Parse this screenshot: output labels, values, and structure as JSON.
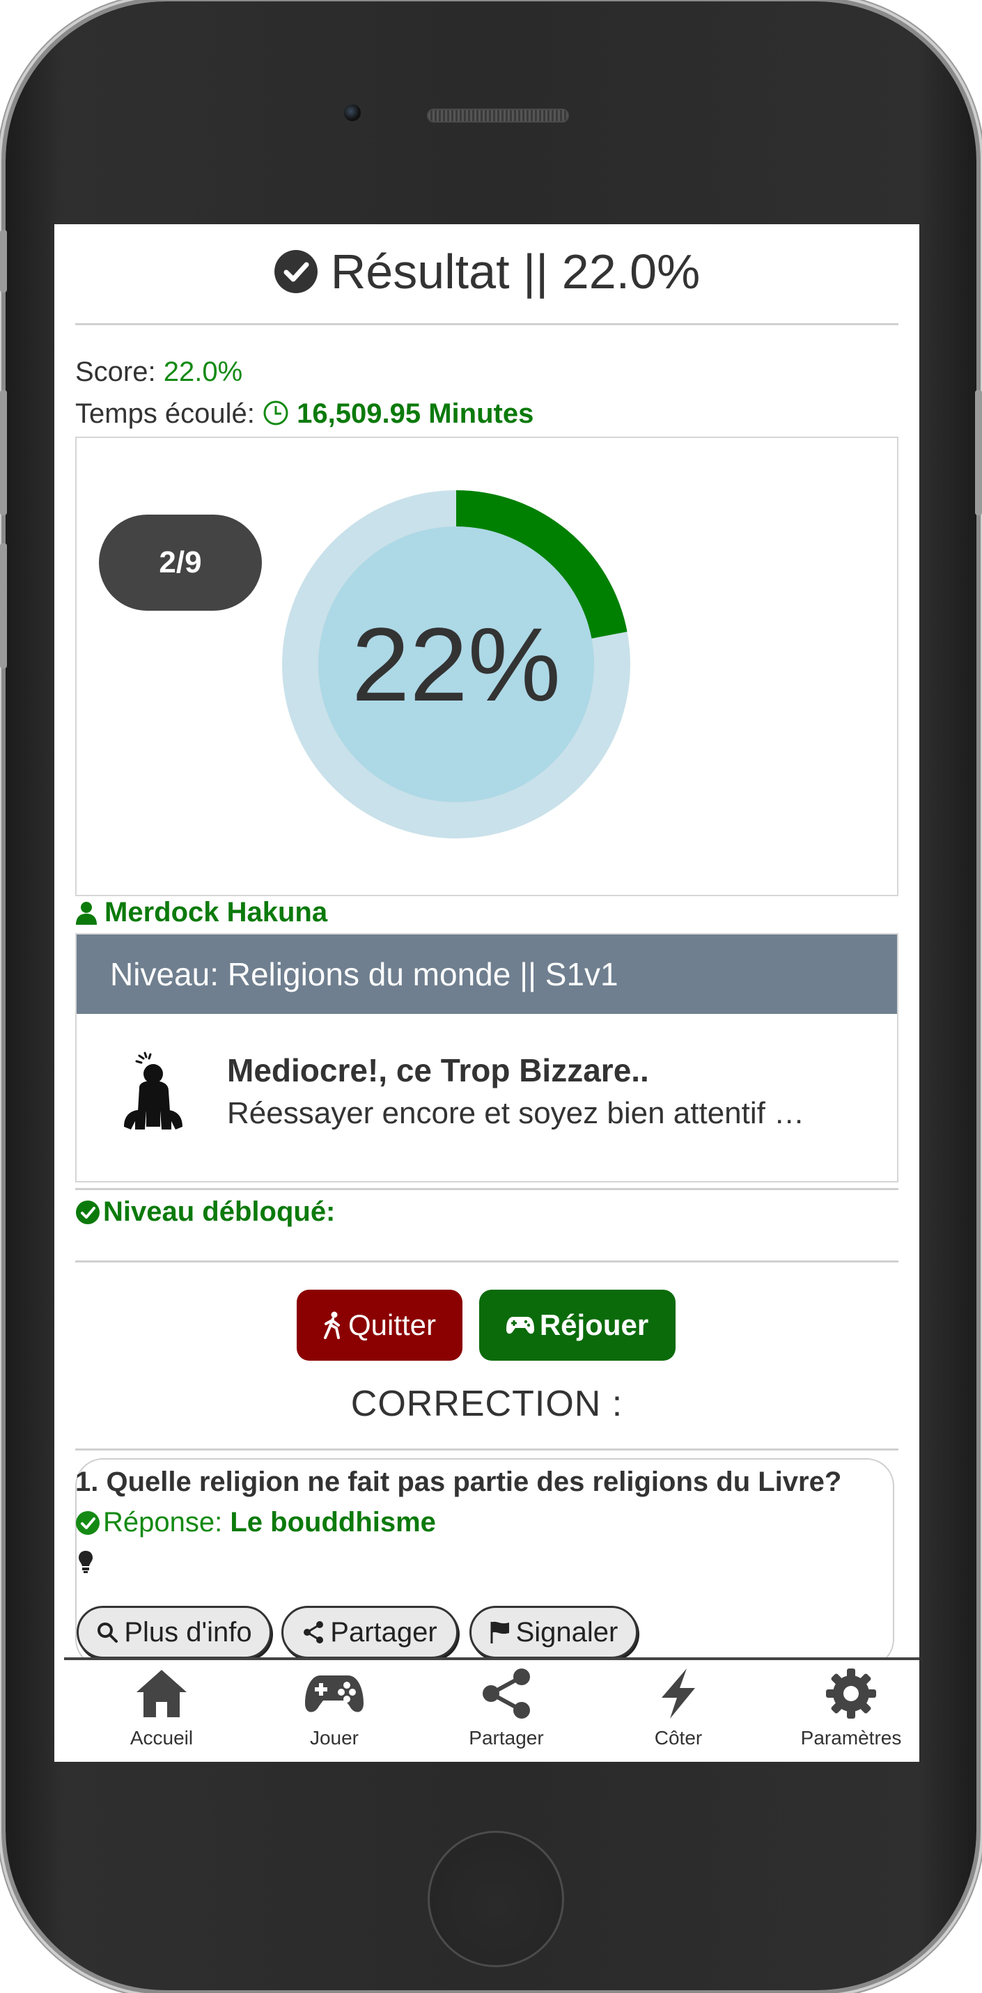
{
  "header": {
    "title": "Résultat || 22.0%"
  },
  "stats": {
    "score_label": "Score:",
    "score_value": "22.0%",
    "time_label": "Temps écoulé:",
    "time_value": "16,509.95 Minutes"
  },
  "progress": {
    "counter": "2/9",
    "percent_label": "22%",
    "fraction": 0.22
  },
  "user": {
    "name": "Merdock Hakuna"
  },
  "level": {
    "header": "Niveau: Religions du monde || S1v1",
    "verdict_title": "Mediocre!, ce Trop Bizzare..",
    "verdict_text": "Réessayer encore et soyez bien attentif …"
  },
  "unlocked": {
    "label": "Niveau débloqué:"
  },
  "actions": {
    "quit_label": "Quitter",
    "replay_label": "Réjouer"
  },
  "correction": {
    "title": "CORRECTION :",
    "questions": [
      {
        "question": "1. Quelle religion ne fait pas partie des religions du Livre?",
        "answer_label": "Réponse:",
        "answer_value": "Le bouddhisme",
        "more_info_label": "Plus d'info",
        "share_label": "Partager",
        "report_label": "Signaler"
      }
    ]
  },
  "nav": {
    "items": [
      {
        "label": "Accueil",
        "icon": "home-icon"
      },
      {
        "label": "Jouer",
        "icon": "gamepad-icon"
      },
      {
        "label": "Partager",
        "icon": "share-icon"
      },
      {
        "label": "Côter",
        "icon": "bolt-icon"
      },
      {
        "label": "Paramètres",
        "icon": "gear-icon"
      }
    ]
  },
  "colors": {
    "success_green": "#148a14",
    "quit_red": "#8b0000",
    "replay_green": "#0b6b0b",
    "level_header": "#6f7f8f",
    "donut_fill": "#add8e6",
    "donut_track": "#c9e1ea",
    "donut_progress": "#008000"
  }
}
